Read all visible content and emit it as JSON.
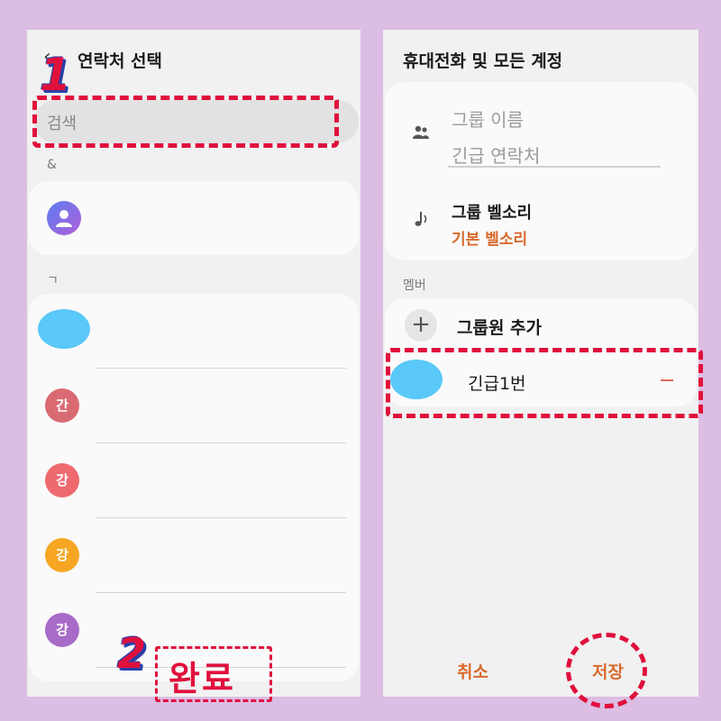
{
  "left_screen": {
    "title": "연락처 선택",
    "search_placeholder": "검색",
    "sections": [
      "&",
      "ㄱ"
    ],
    "contacts": [
      {
        "initial": "",
        "color": "#6a6ee8",
        "icon": "person-icon"
      },
      {
        "initial": "",
        "color": "#5ac8f8",
        "icon": "redacted-blob"
      },
      {
        "initial": "간",
        "color": "#d96a72"
      },
      {
        "initial": "강",
        "color": "#ef6a6e"
      },
      {
        "initial": "강",
        "color": "#f6a623"
      },
      {
        "initial": "강",
        "color": "#a86bc8"
      }
    ],
    "done_label": "완료"
  },
  "right_screen": {
    "title": "휴대전화 및 모든 계정",
    "group_name_label": "그룹 이름",
    "group_name_value": "긴급 연락처",
    "ringtone_label": "그룹 벨소리",
    "ringtone_value": "기본 벨소리",
    "members_label": "멤버",
    "add_member_label": "그룹원 추가",
    "member_name": "긴급1번",
    "cancel_label": "취소",
    "save_label": "저장"
  },
  "annotations": {
    "step1": "1",
    "step2": "2",
    "highlight_color": "#e0103c"
  },
  "colors": {
    "accent": "#d86a2c",
    "background": "#dcbde3"
  }
}
